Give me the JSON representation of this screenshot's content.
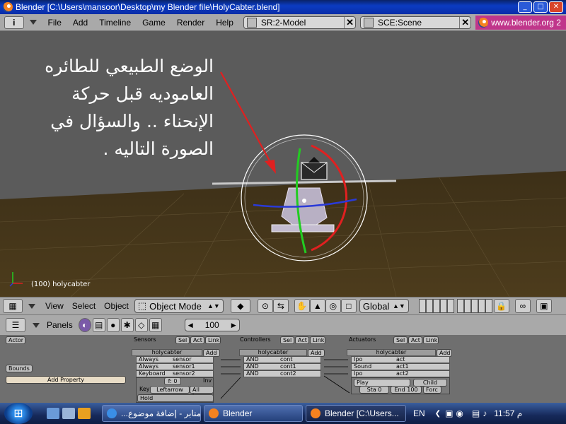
{
  "window": {
    "title": "Blender [C:\\Users\\mansoor\\Desktop\\my Blender file\\HolyCabter.blend]"
  },
  "header": {
    "window_menu": "i",
    "menus": [
      "File",
      "Add",
      "Timeline",
      "Game",
      "Render",
      "Help"
    ],
    "screen_field": "SR:2-Model",
    "scene_field": "SCE:Scene",
    "url": "www.blender.org 2"
  },
  "viewport": {
    "annotation_lines": [
      "الوضع الطبيعي للطائره",
      "العاموديه قبل حركة",
      "الإنحناء .. والسؤال في",
      "الصورة التاليه ."
    ],
    "object_label": "(100) holycabter",
    "colors": {
      "sky": "#5a5a5a",
      "ground": "#4a3a1a",
      "arrow": "#e02020",
      "gizmo_green": "#22cc22",
      "gizmo_red": "#e02020",
      "gizmo_blue": "#2a3ad8"
    }
  },
  "vp_header": {
    "menus": [
      "View",
      "Select",
      "Object"
    ],
    "mode": "Object Mode",
    "orientation": "Global"
  },
  "buttons_header": {
    "panels_label": "Panels",
    "frame": "100"
  },
  "logic": {
    "actor_btn": "Actor",
    "bounds_btn": "Bounds",
    "add_property_btn": "Add Property",
    "sensors": {
      "title": "Sensors",
      "sel": "Sel",
      "act": "Act",
      "link": "Link",
      "object": "holycabter",
      "add": "Add",
      "rows": [
        {
          "type": "Always",
          "name": "sensor"
        },
        {
          "type": "Always",
          "name": "sensor1"
        },
        {
          "type": "Keyboard",
          "name": "sensor2"
        }
      ],
      "f_value": "f: 0",
      "inv": "Inv",
      "key_label": "Key",
      "key_value": "Leftarrow",
      "all_keys": "All keys",
      "hold": "Hold"
    },
    "controllers": {
      "title": "Controllers",
      "sel": "Sel",
      "act": "Act",
      "link": "Link",
      "object": "holycabter",
      "add": "Add",
      "rows": [
        {
          "type": "AND",
          "name": "cont"
        },
        {
          "type": "AND",
          "name": "cont1"
        },
        {
          "type": "AND",
          "name": "cont2"
        }
      ]
    },
    "actuators": {
      "title": "Actuators",
      "sel": "Sel",
      "act": "Act",
      "link": "Link",
      "object": "holycabter",
      "add": "Add",
      "rows": [
        {
          "type": "Ipo",
          "name": "act"
        },
        {
          "type": "Sound",
          "name": "act1"
        },
        {
          "type": "Ipo",
          "name": "act2"
        }
      ],
      "play": "Play",
      "child": "Child",
      "sta": "Sta 0",
      "end": "End 100",
      "force": "Forc"
    }
  },
  "taskbar": {
    "tasks": [
      {
        "label": "...المنابر - إضافة موضوع",
        "icon_color": "#3a8ee6"
      },
      {
        "label": "Blender",
        "icon_color": "#f58220"
      },
      {
        "label": "Blender [C:\\Users...",
        "icon_color": "#f58220"
      }
    ],
    "lang": "EN",
    "clock": "11:57 م"
  }
}
